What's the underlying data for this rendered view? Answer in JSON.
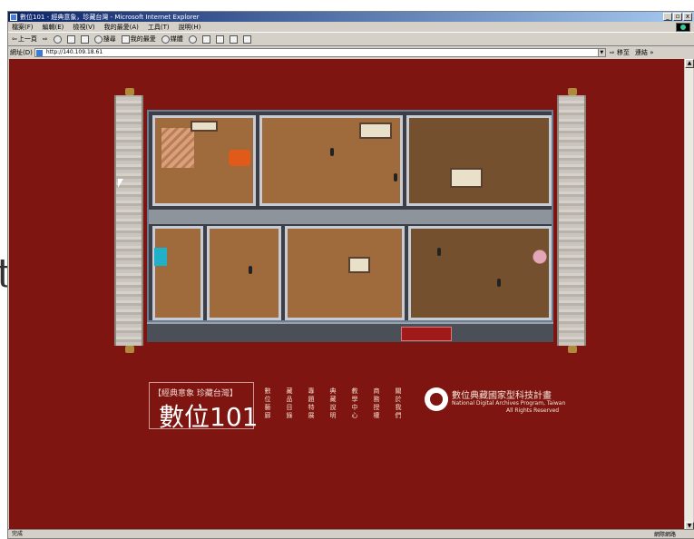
{
  "window": {
    "title": "數位101 - 經典意象，珍藏台灣 - Microsoft Internet Explorer",
    "controls": [
      "_",
      "▫",
      "x"
    ]
  },
  "menu": {
    "items": [
      "檔案(F)",
      "編輯(E)",
      "檢視(V)",
      "我的最愛(A)",
      "工具(T)",
      "說明(H)"
    ]
  },
  "toolbar": {
    "back_label": "上一頁",
    "search_label": "搜尋",
    "favorites_label": "我的最愛",
    "media_label": "媒體"
  },
  "address": {
    "label": "網址(D)",
    "url": "http://140.109.18.61",
    "go_label": "移至",
    "links_label": "連結"
  },
  "status": {
    "text": "完成",
    "zone": "網際網路"
  },
  "page": {
    "brand_sub": "【經典意象 珍藏台灣】",
    "brand_main": "數位101",
    "nav": [
      "數位藝廊",
      "藏品目錄",
      "專題特展",
      "典藏說明",
      "教學中心",
      "商務授權",
      "關於我們"
    ],
    "archives_title": "數位典藏國家型科技計畫",
    "archives_en": "National Digital Archives Program, Taiwan",
    "rights": "All Rights Reserved"
  },
  "colors": {
    "page_bg": "#7e1510",
    "title_bar": "#0a246a"
  }
}
